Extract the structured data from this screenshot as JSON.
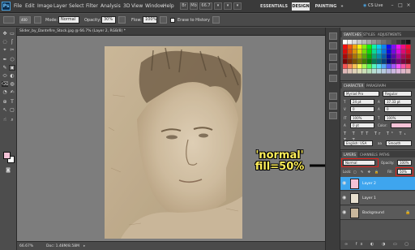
{
  "app": {
    "logo": "Ps",
    "menu": [
      "File",
      "Edit",
      "Image",
      "Layer",
      "Select",
      "Filter",
      "Analysis",
      "3D",
      "View",
      "Window",
      "Help"
    ],
    "mini_controls": [
      "Br",
      "Mb",
      "66.7",
      "▾",
      "▾",
      "▾"
    ],
    "workspaces": [
      "ESSENTIALS",
      "DESIGN",
      "PAINTING",
      "»"
    ],
    "active_workspace": "DESIGN",
    "cs_live": "CS Live",
    "window_buttons": [
      "–",
      "□",
      "×"
    ]
  },
  "options_bar": {
    "brush_size": "400",
    "mode_label": "Mode:",
    "mode_value": "Normal",
    "opacity_label": "Opacity:",
    "opacity_value": "30%",
    "flow_label": "Flow:",
    "flow_value": "100%",
    "erase_to_history": "Erase to History"
  },
  "document": {
    "tab_title": "Slider_by_Dantefire_Stock.jpg @ 66.7% (Layer 2, RGB/8) *",
    "zoom": "66.67%",
    "doc_size": "Doc: 1.48M/8.58M"
  },
  "tools": [
    "▭",
    "✥",
    "◌",
    "ʃ",
    "⌖",
    "✂",
    "✒",
    "⬡",
    "✎",
    "▣",
    "⬭",
    "◐",
    "⌫",
    "◍",
    "◔",
    "✍",
    "⊕",
    "T",
    "↖",
    "▢",
    "☝",
    "⌕"
  ],
  "colors": {
    "foreground": "#f4c2d6",
    "background": "#ffffff"
  },
  "swatches_panel": {
    "tabs": [
      "SWATCHES",
      "STYLES",
      "ADJUSTMENTS"
    ]
  },
  "character_panel": {
    "tabs": [
      "CHARACTER",
      "PARAGRAPH"
    ],
    "font_family": "Myriad Pro",
    "font_style": "Regular",
    "font_size": "24 pt",
    "leading": "37.33 pt",
    "kerning": "0",
    "tracking": "0",
    "vertical_scale": "100%",
    "horizontal_scale": "100%",
    "baseline_shift": "0 pt",
    "color_label": "Color:",
    "language": "English: USA",
    "anti_alias": "Smooth"
  },
  "layers_panel": {
    "tabs": [
      "LAYERS",
      "CHANNELS",
      "PATHS"
    ],
    "blend_mode": "Normal",
    "opacity_label": "Opacity:",
    "opacity_value": "100%",
    "lock_label": "Lock:",
    "fill_label": "Fill:",
    "fill_value": "50%",
    "layers": [
      {
        "name": "Layer 2",
        "selected": true
      },
      {
        "name": "Layer 1",
        "selected": false
      },
      {
        "name": "Background",
        "selected": false
      }
    ]
  },
  "annotation": {
    "line1": "'normal'",
    "line2": "fill=50%"
  }
}
